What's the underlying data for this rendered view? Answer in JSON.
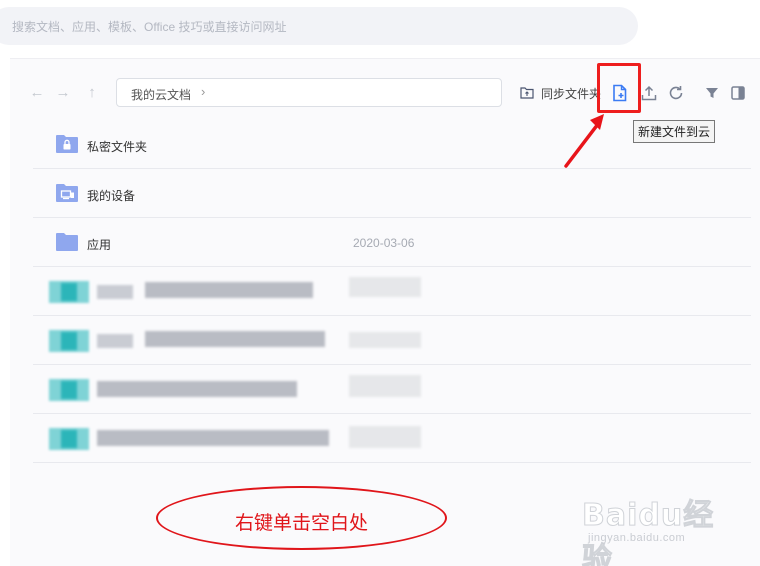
{
  "search": {
    "placeholder": "搜索文档、应用、模板、Office 技巧或直接访问网址"
  },
  "breadcrumb": {
    "root": "我的云文档",
    "chevron": "›"
  },
  "toolbar": {
    "sync_label": "同步文件夹",
    "new_file_tooltip": "新建文件到云"
  },
  "files": [
    {
      "name": "私密文件夹",
      "date": "",
      "icon": "lock-folder-icon"
    },
    {
      "name": "我的设备",
      "date": "",
      "icon": "device-folder-icon"
    },
    {
      "name": "应用",
      "date": "2020-03-06",
      "icon": "folder-icon"
    }
  ],
  "annotation": {
    "text": "右键单击空白处"
  },
  "watermark": {
    "brand": "Baidu经验",
    "url": "jingyan.baidu.com"
  },
  "colors": {
    "accent": "#3b7bf3",
    "folder": "#8fa7ee",
    "annotation": "#e0151a"
  }
}
